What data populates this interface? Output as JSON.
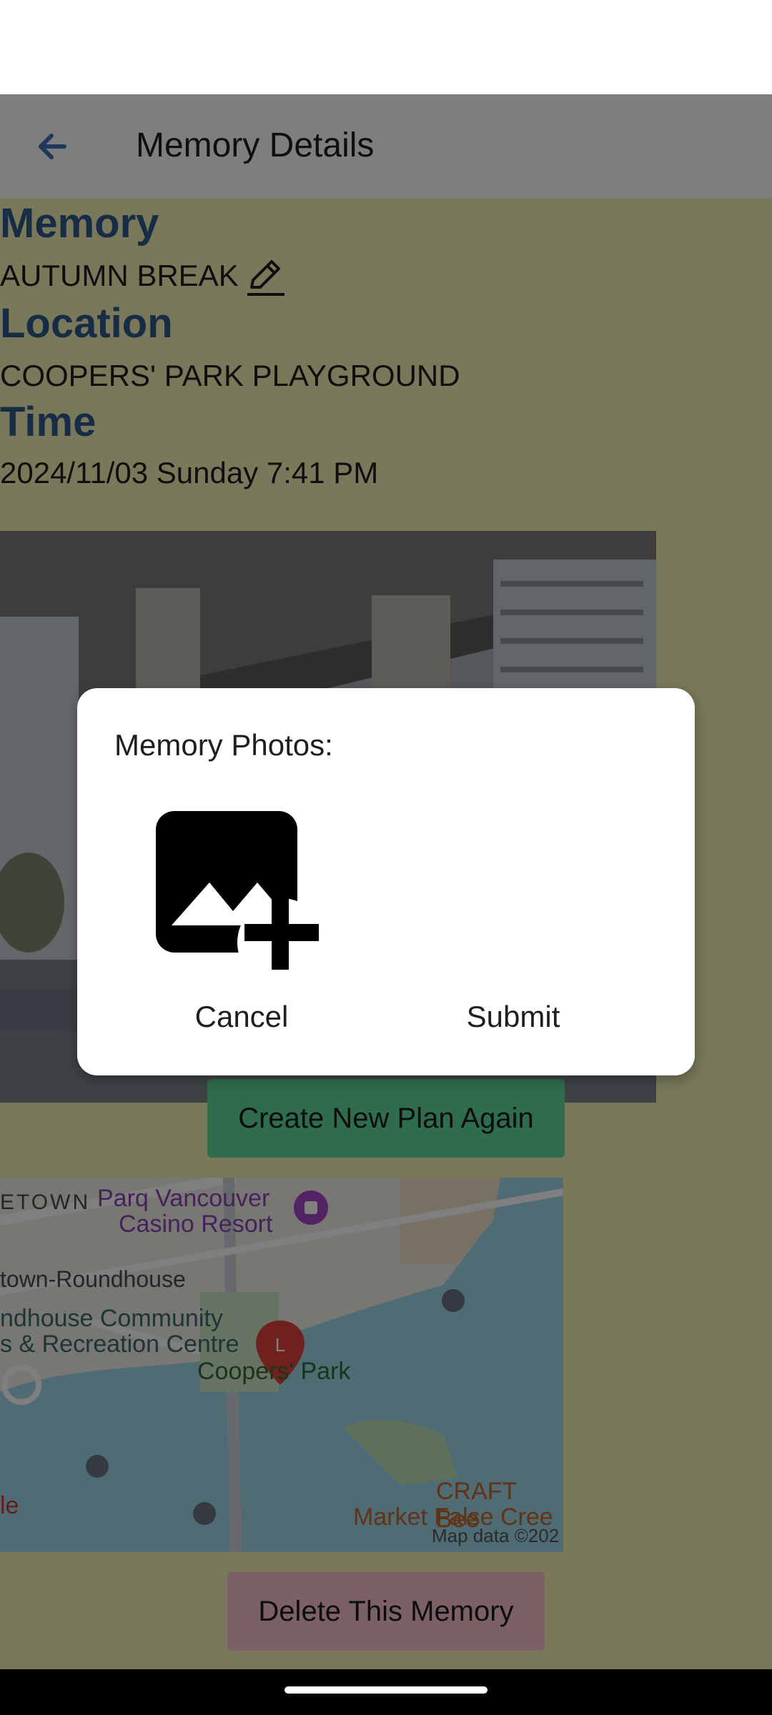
{
  "app_bar": {
    "title": "Memory Details"
  },
  "memory": {
    "memory_label": "Memory",
    "memory_value": "AUTUMN BREAK",
    "location_label": "Location",
    "location_value": "COOPERS' PARK PLAYGROUND",
    "time_label": "Time",
    "time_value": "2024/11/03 Sunday 7:41 PM"
  },
  "buttons": {
    "create_plan": "Create New Plan Again",
    "delete_memory": "Delete This Memory"
  },
  "map": {
    "labels": {
      "area1": "ETOWN",
      "poi1": "Parq Vancouver",
      "poi1b": "Casino Resort",
      "area2": "town-Roundhouse",
      "poi2": "ndhouse Community",
      "poi2b": "s & Recreation Centre",
      "pin": "L",
      "park": "Coopers' Park",
      "poi3": "CRAFT Bee",
      "poi4": "Market False Cree",
      "corner": "le",
      "attribution": "Map data ©202"
    }
  },
  "dialog": {
    "title": "Memory Photos:",
    "cancel": "Cancel",
    "submit": "Submit"
  },
  "colors": {
    "accent_label": "#2e5a8a",
    "content_bg": "#f2f0b4",
    "create_button": "#5fd89a",
    "delete_button": "#f6c2cc",
    "back_arrow": "#3f6fb4"
  },
  "icons": {
    "back": "arrow-left-icon",
    "edit": "pencil-icon",
    "add_photo": "add-photo-icon",
    "map_pin": "map-pin-icon"
  }
}
